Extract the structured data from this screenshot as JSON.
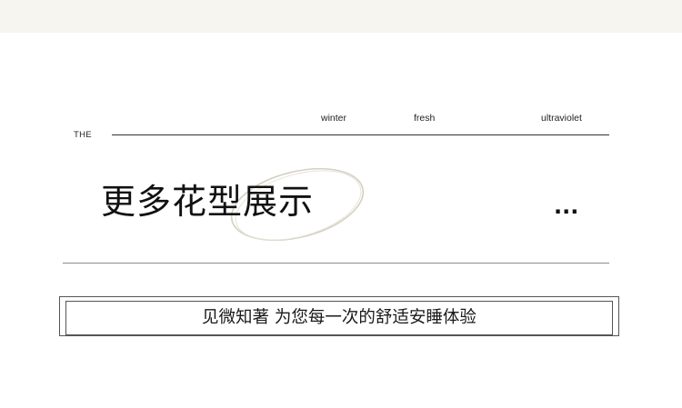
{
  "header": {
    "the_label": "THE",
    "tags": [
      "winter",
      "fresh",
      "ultraviolet"
    ]
  },
  "title": {
    "text": "更多花型展示",
    "more_indicator": "..."
  },
  "slogan": {
    "text": "见微知著 为您每一次的舒适安睡体验"
  },
  "colors": {
    "top_band": "#f6f5f0",
    "oval_stroke": "#d4d0c2",
    "text": "#111111"
  }
}
